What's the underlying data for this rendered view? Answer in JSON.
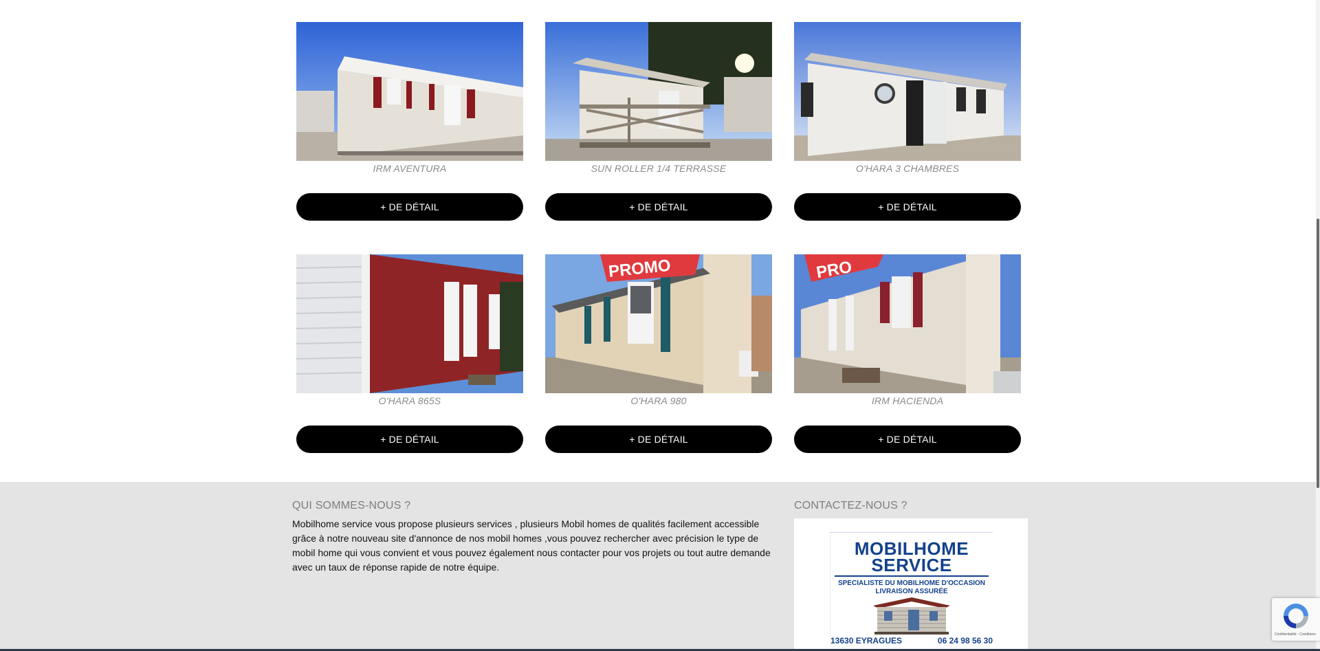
{
  "products": [
    {
      "name": "IRM AVENTURA",
      "button_label": "+ DE DÉTAIL",
      "photo": "mobile-home-photo",
      "promo": false
    },
    {
      "name": "SUN ROLLER 1/4 TERRASSE",
      "button_label": "+ DE DÉTAIL",
      "photo": "mobile-home-photo",
      "promo": false
    },
    {
      "name": "O'HARA 3 CHAMBRES",
      "button_label": "+ DE DÉTAIL",
      "photo": "mobile-home-photo",
      "promo": false
    },
    {
      "name": "O'HARA 865S",
      "button_label": "+ DE DÉTAIL",
      "photo": "mobile-home-photo",
      "promo": false
    },
    {
      "name": "O'HARA 980",
      "button_label": "+ DE DÉTAIL",
      "photo": "mobile-home-photo",
      "promo": true,
      "promo_text": "PROMO"
    },
    {
      "name": "IRM HACIENDA",
      "button_label": "+ DE DÉTAIL",
      "photo": "mobile-home-photo",
      "promo": true,
      "promo_text": "PRO"
    }
  ],
  "footer": {
    "about_title": "QUI SOMMES-NOUS ?",
    "about_text": "Mobilhome service vous propose plusieurs services , plusieurs Mobil homes de qualités facilement accessible grâce à notre nouveau site d'annonce de nos mobil homes ,vous pouvez rechercher avec précision le type de mobil home qui vous convient et vous pouvez également nous contacter pour vos projets ou tout autre demande avec un taux de réponse rapide de notre équipe.",
    "contact_title": "CONTACTEZ-NOUS ?",
    "logo": {
      "line1": "MOBILHOME",
      "line2": "SERVICE",
      "tagline1": "SPECIALISTE DU MOBILHOME D'OCCASION",
      "tagline2": "LIVRAISON ASSURÉE",
      "city": "13630 EYRAGUES",
      "phone": "06 24 98 56 30"
    }
  },
  "recaptcha": {
    "text": "Confidentialité - Conditions"
  },
  "colors": {
    "button_bg": "#000000",
    "footer_bg": "#e4e4e4",
    "brand_blue": "#13418b",
    "title_grey": "#8a8a8a"
  }
}
